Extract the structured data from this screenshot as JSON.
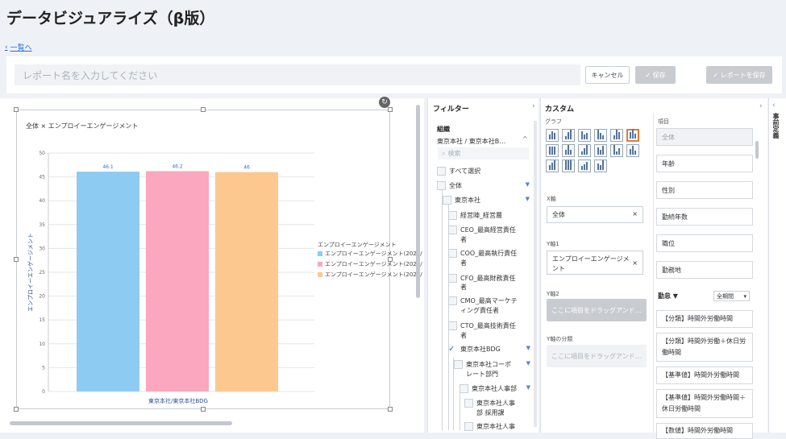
{
  "page": {
    "title": "データビジュアライズ（β版）",
    "back_label": "一覧へ"
  },
  "toolbar": {
    "report_name_placeholder": "レポート名を入力してください",
    "cancel_label": "キャンセル",
    "save_label": "✓ 保存",
    "save_report_label": "✓ レポートを保存"
  },
  "chart_data": {
    "type": "bar",
    "title": "全体 × エンプロイーエンゲージメント",
    "categories": [
      "東京本社/東京本社BDG"
    ],
    "xlabel": "東京本社/東京本社BDG",
    "ylabel": "エンプロイーエンゲージメント",
    "ylim": [
      0,
      50
    ],
    "yticks": [
      "0",
      "5",
      "10",
      "15",
      "20",
      "25",
      "30",
      "35",
      "40",
      "45",
      "50"
    ],
    "legend_title": "エンプロイーエンゲージメント",
    "legend_position": "right",
    "series": [
      {
        "name": "エンプロイーエンゲージメント(2023/",
        "values": [
          46.1
        ],
        "label": "46.1",
        "color": "#8ecbf3"
      },
      {
        "name": "エンプロイーエンゲージメント(2022/",
        "values": [
          46.2
        ],
        "label": "46.2",
        "color": "#fba7bf"
      },
      {
        "name": "エンプロイーエンゲージメント(2021/",
        "values": [
          46
        ],
        "label": "46",
        "color": "#fdc88f"
      }
    ]
  },
  "filter": {
    "heading": "フィルター",
    "org_heading": "組織",
    "org_selected": "東京本社 / 東京本社B…",
    "search_placeholder": "検索",
    "items": [
      {
        "label": "すべて選択"
      },
      {
        "label": "全体"
      },
      {
        "label": "東京本社"
      },
      {
        "label": "経営陣_経営層"
      },
      {
        "label": "CEO_最高経営責任者"
      },
      {
        "label": "COO_最高執行責任者"
      },
      {
        "label": "CFO_最高財務責任者"
      },
      {
        "label": "CMO_最高マーケティング責任者"
      },
      {
        "label": "CTO_最高技術責任者"
      },
      {
        "label": "東京本社BDG"
      },
      {
        "label": "東京本社コーポレート部門"
      },
      {
        "label": "東京本社人事部"
      },
      {
        "label": "東京本社人事部 採用課"
      },
      {
        "label": "東京本社人事"
      }
    ]
  },
  "custom": {
    "heading": "カスタム",
    "graph_label": "グラフ",
    "x_axis_label": "X軸",
    "x_axis_value": "全体",
    "y1_label": "Y軸1",
    "y1_value": "エンプロイーエンゲージメント",
    "y2_label": "Y軸2",
    "y2_placeholder": "ここに項目をドラッグアンド…",
    "ysplit_label": "Y軸の分類",
    "ysplit_placeholder": "ここに項目をドラッグアンド…",
    "items_heading": "項目",
    "items": [
      "全体",
      "年齢",
      "性別",
      "勤続年数",
      "職位",
      "勤務地"
    ],
    "attendance_label": "勤怠 ▼",
    "period_label": "全期間",
    "attendance_items": [
      "【分類】時間外労働時間",
      "【分類】時間外労働＋休日労働時間",
      "【基準値】時間外労働時間",
      "【基準値】時間外労働時間＋休日労働時間",
      "【数値】時間外労働時間"
    ]
  },
  "right_strip": {
    "label": "事前定義"
  }
}
